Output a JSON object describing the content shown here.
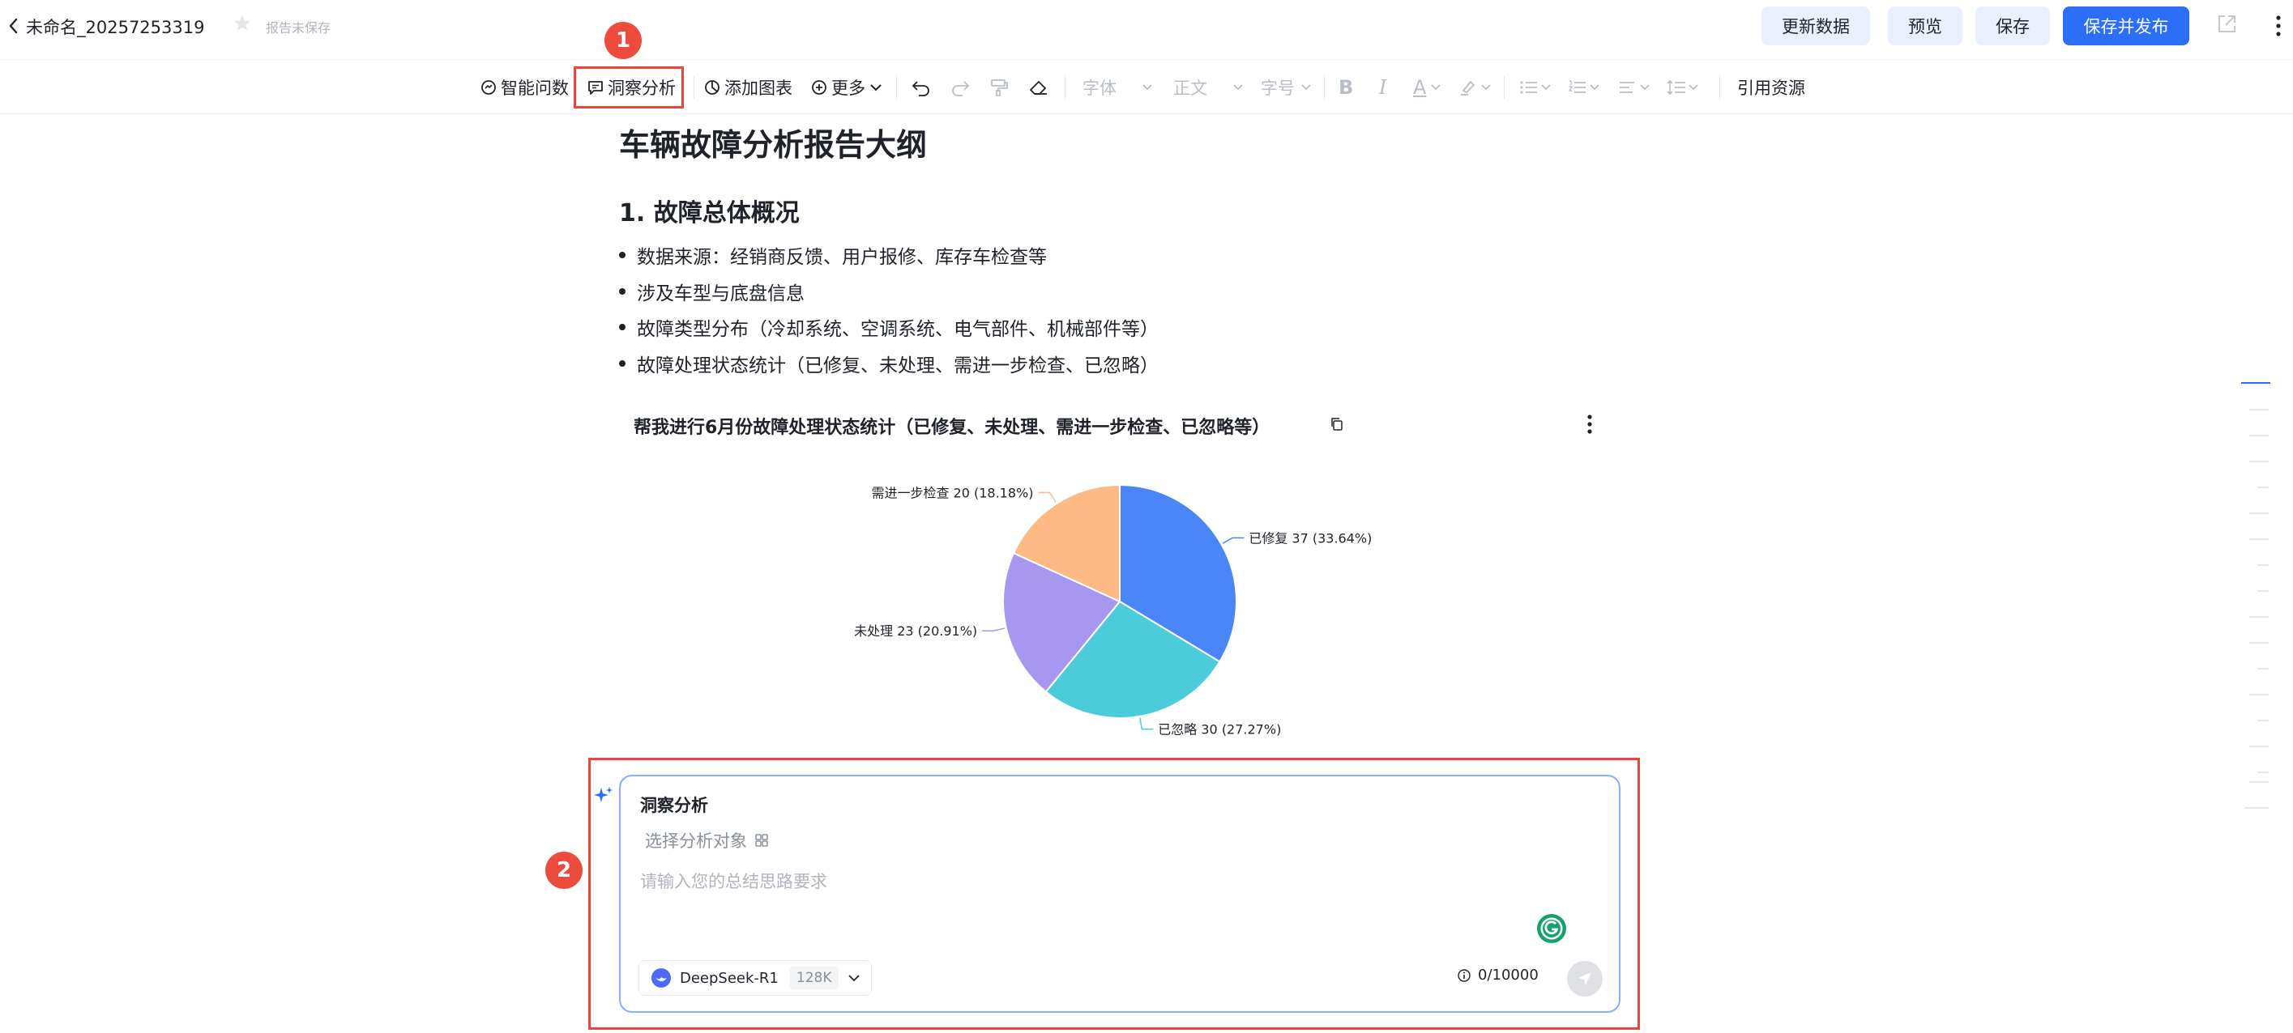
{
  "header": {
    "doc_title": "未命名_20257253319",
    "save_status": "报告未保存",
    "buttons": {
      "refresh": "更新数据",
      "preview": "预览",
      "save": "保存",
      "save_publish": "保存并发布"
    }
  },
  "toolbar": {
    "smart_query": "智能问数",
    "insight": "洞察分析",
    "add_chart": "添加图表",
    "more": "更多",
    "font": "字体",
    "paragraph": "正文",
    "font_size": "字号",
    "bold": "B",
    "italic": "I",
    "font_color": "A",
    "cite": "引用资源"
  },
  "callouts": {
    "one": "1",
    "two": "2"
  },
  "document": {
    "title": "车辆故障分析报告大纲",
    "section1": "1. 故障总体概况",
    "bullets": [
      "数据来源：经销商反馈、用户报修、库存车检查等",
      "涉及车型与底盘信息",
      "故障类型分布（冷却系统、空调系统、电气部件、机械部件等）",
      "故障处理状态统计（已修复、未处理、需进一步检查、已忽略）"
    ]
  },
  "chart_data": {
    "type": "pie",
    "title": "帮我进行6月份故障处理状态统计（已修复、未处理、需进一步检查、已忽略等）",
    "slices": [
      {
        "name": "已修复",
        "value": 37,
        "percent": "33.64%",
        "color": "#4a86f7",
        "label": "已修复 37 (33.64%)"
      },
      {
        "name": "已忽略",
        "value": 30,
        "percent": "27.27%",
        "color": "#4ccbdb",
        "label": "已忽略 30 (27.27%)"
      },
      {
        "name": "未处理",
        "value": 23,
        "percent": "20.91%",
        "color": "#a897f0",
        "label": "未处理 23 (20.91%)"
      },
      {
        "name": "需进一步检查",
        "value": 20,
        "percent": "18.18%",
        "color": "#fdba84",
        "label": "需进一步检查 20 (18.18%)"
      }
    ]
  },
  "insight_panel": {
    "title": "洞察分析",
    "select_target": "选择分析对象",
    "prompt_placeholder": "请输入您的总结思路要求",
    "model": "DeepSeek-R1",
    "context": "128K",
    "counter": "0/10000"
  }
}
